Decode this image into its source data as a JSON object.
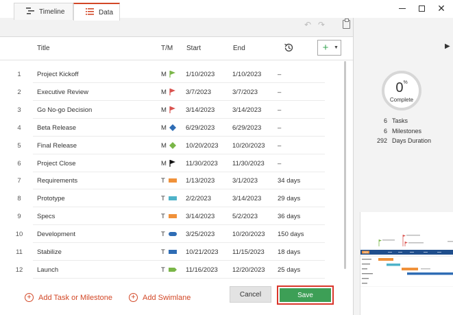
{
  "tabs": {
    "timeline": "Timeline",
    "data": "Data"
  },
  "columns": {
    "title": "Title",
    "type": "T/M",
    "start": "Start",
    "end": "End"
  },
  "rows": [
    {
      "num": "1",
      "title": "Project Kickoff",
      "type": "M",
      "marker": "flag-green",
      "start": "1/10/2023",
      "end": "1/10/2023",
      "duration": "–"
    },
    {
      "num": "2",
      "title": "Executive Review",
      "type": "M",
      "marker": "flag-red",
      "start": "3/7/2023",
      "end": "3/7/2023",
      "duration": "–"
    },
    {
      "num": "3",
      "title": "Go No-go Decision",
      "type": "M",
      "marker": "flag-red",
      "start": "3/14/2023",
      "end": "3/14/2023",
      "duration": "–"
    },
    {
      "num": "4",
      "title": "Beta Release",
      "type": "M",
      "marker": "diamond-blue",
      "start": "6/29/2023",
      "end": "6/29/2023",
      "duration": "–"
    },
    {
      "num": "5",
      "title": "Final Release",
      "type": "M",
      "marker": "diamond-green",
      "start": "10/20/2023",
      "end": "10/20/2023",
      "duration": "–"
    },
    {
      "num": "6",
      "title": "Project Close",
      "type": "M",
      "marker": "flag-black",
      "start": "11/30/2023",
      "end": "11/30/2023",
      "duration": "–"
    },
    {
      "num": "7",
      "title": "Requirements",
      "type": "T",
      "marker": "bar-orange",
      "start": "1/13/2023",
      "end": "3/1/2023",
      "duration": "34 days"
    },
    {
      "num": "8",
      "title": "Prototype",
      "type": "T",
      "marker": "bar-teal",
      "start": "2/2/2023",
      "end": "3/14/2023",
      "duration": "29 days"
    },
    {
      "num": "9",
      "title": "Specs",
      "type": "T",
      "marker": "bar-orange",
      "start": "3/14/2023",
      "end": "5/2/2023",
      "duration": "36 days"
    },
    {
      "num": "10",
      "title": "Development",
      "type": "T",
      "marker": "pill-blue",
      "start": "3/25/2023",
      "end": "10/20/2023",
      "duration": "150 days"
    },
    {
      "num": "11",
      "title": "Stabilize",
      "type": "T",
      "marker": "bar-blue",
      "start": "10/21/2023",
      "end": "11/15/2023",
      "duration": "18 days"
    },
    {
      "num": "12",
      "title": "Launch",
      "type": "T",
      "marker": "tag-green",
      "start": "11/16/2023",
      "end": "12/20/2023",
      "duration": "25 days"
    }
  ],
  "actions": {
    "add_task": "Add Task or Milestone",
    "add_swimlane": "Add Swimlane",
    "cancel": "Cancel",
    "save": "Save"
  },
  "summary": {
    "percent": "0",
    "percent_sign": "%",
    "complete_label": "Complete",
    "tasks_count": "6",
    "tasks_label": "Tasks",
    "milestones_count": "6",
    "milestones_label": "Milestones",
    "duration_count": "292",
    "duration_label": "Days Duration"
  },
  "colors": {
    "accent": "#d24726",
    "save_green": "#3d9f56",
    "flag_green": "#7ab648",
    "flag_red": "#d9534f",
    "blue": "#2f6db5",
    "orange": "#f0913a",
    "teal": "#4fb3c9"
  },
  "thumbnail": {
    "year_label": "2023"
  }
}
